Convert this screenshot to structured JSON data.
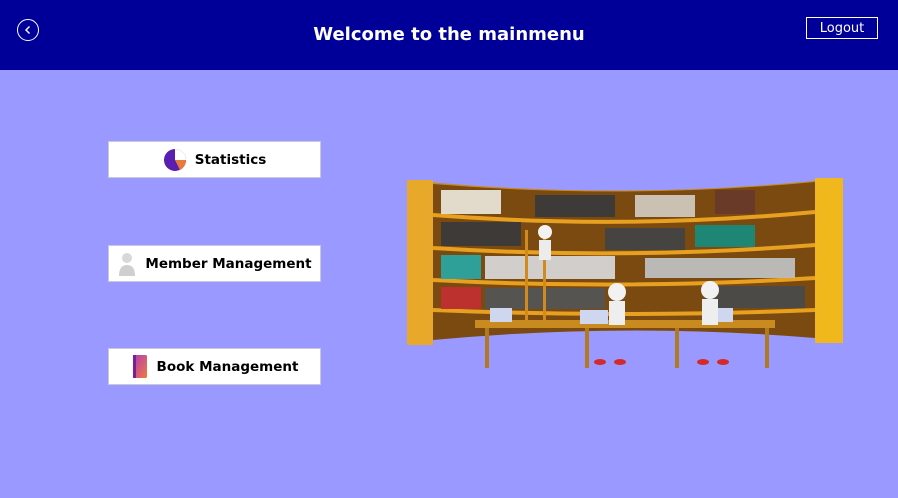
{
  "header": {
    "title": "Welcome to the mainmenu",
    "logout_label": "Logout",
    "back_icon": "chevron-left-icon"
  },
  "menu": {
    "statistics_label": "Statistics",
    "member_management_label": "Member Management",
    "book_management_label": "Book Management"
  },
  "colors": {
    "header_bg": "#000099",
    "page_bg": "#9999ff",
    "button_bg": "#ffffff"
  }
}
